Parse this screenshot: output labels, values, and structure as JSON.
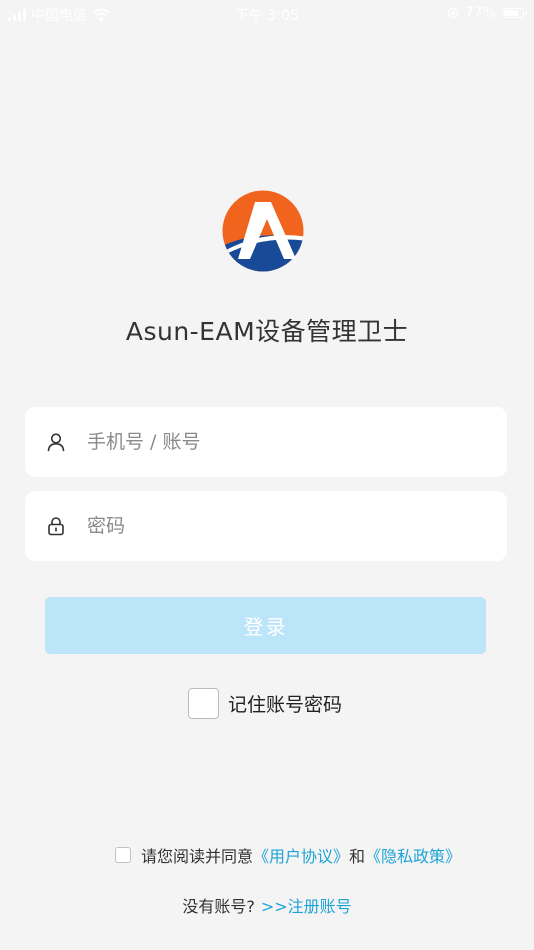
{
  "status_bar": {
    "carrier": "中国电信",
    "time": "下午 3:05",
    "battery": "77%",
    "battery_level": 0.77
  },
  "app": {
    "title": "Asun-EAM设备管理卫士",
    "logo_letter": "A",
    "colors": {
      "logo_orange": "#f0641e",
      "logo_blue": "#184a98",
      "accent": "#1fa3d6",
      "login_button": "#bde5fa"
    }
  },
  "form": {
    "account_placeholder": "手机号 / 账号",
    "password_placeholder": "密码",
    "account_icon": "user-icon",
    "password_icon": "lock-icon",
    "login_label": "登录",
    "remember_label": "记住账号密码"
  },
  "agreement": {
    "prefix": "请您阅读并同意",
    "user_agreement": "《用户协议》",
    "and": "和",
    "privacy_policy": "《隐私政策》"
  },
  "register": {
    "prompt": "没有账号?",
    "link": ">>注册账号"
  }
}
